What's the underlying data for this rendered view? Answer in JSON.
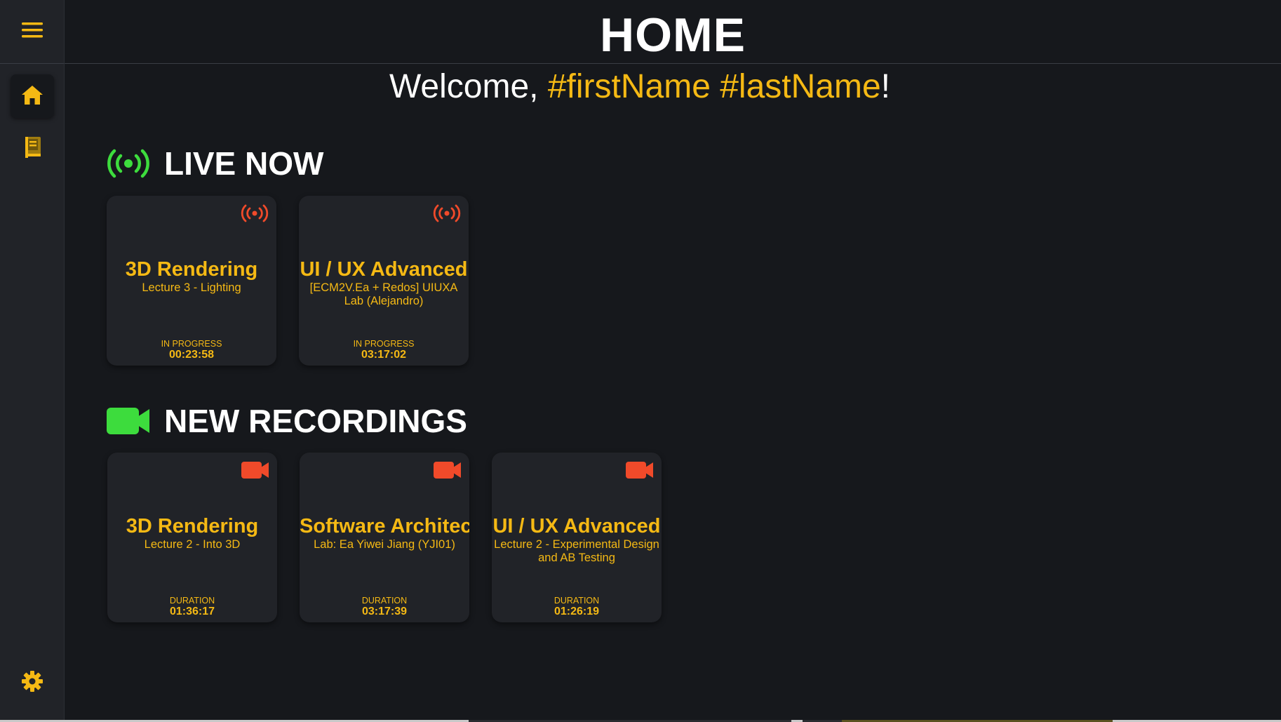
{
  "header": {
    "title": "HOME"
  },
  "welcome": {
    "prefix": "Welcome, ",
    "first_name": "#firstName",
    "separator": " ",
    "last_name": "#lastName",
    "suffix": "!"
  },
  "sidebar": {
    "menu_icon": "hamburger-menu-icon",
    "items": [
      {
        "icon": "home-icon",
        "active": true
      },
      {
        "icon": "book-icon",
        "active": false
      }
    ],
    "settings_icon": "gear-icon"
  },
  "live_now": {
    "title": "LIVE NOW",
    "icon": "broadcast-icon",
    "cards": [
      {
        "title": "3D Rendering",
        "subtitle": "Lecture 3 - Lighting",
        "status": "IN PROGRESS",
        "time": "00:23:58",
        "icon": "broadcast-icon"
      },
      {
        "title": "UI / UX Advanced",
        "subtitle": "[ECM2V.Ea + Redos] UIUXA Lab (Alejandro)",
        "status": "IN PROGRESS",
        "time": "03:17:02",
        "icon": "broadcast-icon"
      }
    ]
  },
  "new_recordings": {
    "title": "NEW RECORDINGS",
    "icon": "video-camera-icon",
    "cards": [
      {
        "title": "3D Rendering",
        "subtitle": "Lecture 2 - Into 3D",
        "status": "DURATION",
        "time": "01:36:17",
        "icon": "video-camera-icon"
      },
      {
        "title": "Software Architec",
        "subtitle": "Lab: Ea Yiwei Jiang (YJI01)",
        "status": "DURATION",
        "time": "03:17:39",
        "icon": "video-camera-icon"
      },
      {
        "title": "UI / UX Advanced",
        "subtitle": "Lecture 2 - Experimental Design and AB Testing",
        "status": "DURATION",
        "time": "01:26:19",
        "icon": "video-camera-icon"
      }
    ]
  },
  "colors": {
    "background": "#16181c",
    "sidebar": "#212328",
    "card": "#212328",
    "accent": "#f5b914",
    "live_green": "#3ddc3d",
    "live_red": "#f04a2a",
    "text": "#ffffff"
  }
}
